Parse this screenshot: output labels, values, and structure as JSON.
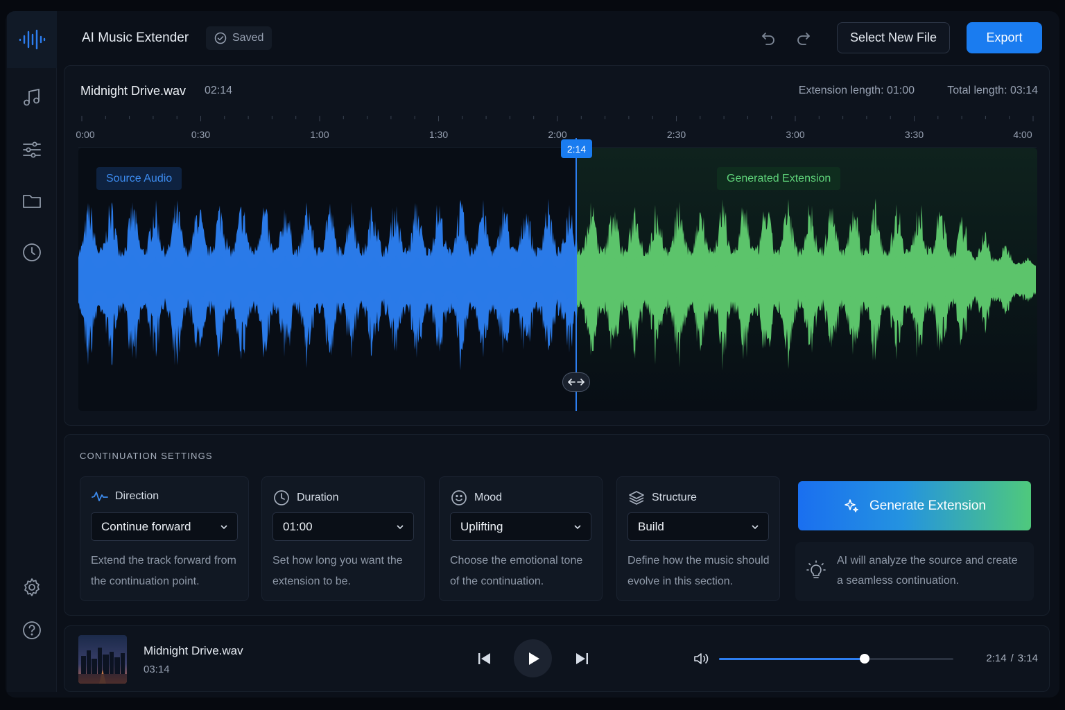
{
  "app": {
    "title": "AI Music Extender",
    "saved_label": "Saved",
    "select_file_label": "Select New File",
    "export_label": "Export"
  },
  "sidebar": {
    "items": [
      {
        "name": "waveform-logo-icon"
      },
      {
        "name": "music-note-icon"
      },
      {
        "name": "sliders-icon"
      },
      {
        "name": "folder-icon"
      },
      {
        "name": "history-clock-icon"
      },
      {
        "name": "settings-gear-icon"
      },
      {
        "name": "help-icon"
      }
    ]
  },
  "track": {
    "file_name": "Midnight Drive.wav",
    "duration": "02:14",
    "extension_length": "Extension length: 01:00",
    "total_length": "Total length: 03:14"
  },
  "timeline": {
    "ticks": [
      "0:00",
      "0:30",
      "1:00",
      "1:30",
      "2:00",
      "2:30",
      "3:00",
      "3:30",
      "4:00"
    ],
    "playhead_label": "2:14"
  },
  "waveform": {
    "source_label": "Source Audio",
    "generated_label": "Generated Extension"
  },
  "settings": {
    "title": "CONTINUATION SETTINGS",
    "cards": [
      {
        "label": "Direction",
        "value": "Continue forward",
        "desc": "Extend the track forward from the continuation point."
      },
      {
        "label": "Duration",
        "value": "01:00",
        "desc": "Set how long you want the extension to be."
      },
      {
        "label": "Mood",
        "value": "Uplifting",
        "desc": "Choose the emotional tone of the continuation."
      },
      {
        "label": "Structure",
        "value": "Build",
        "desc": "Define how the music should evolve in this section."
      }
    ],
    "generate_label": "Generate Extension",
    "hint": "AI will analyze the source and create a seamless continuation."
  },
  "player": {
    "name": "Midnight Drive.wav",
    "duration": "03:14",
    "current_time": "2:14",
    "separator": "/",
    "total_time": "3:14",
    "volume": 0.62
  },
  "colors": {
    "accent": "#1a7cf0",
    "source_wave": "#2a7ae8",
    "generated_wave": "#5cc46b",
    "background": "#0b1019"
  }
}
